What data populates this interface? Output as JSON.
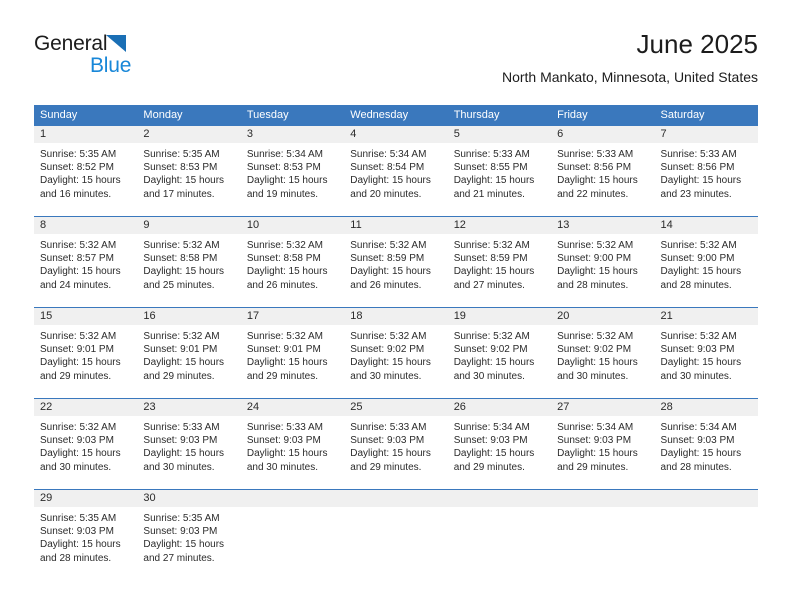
{
  "logo": {
    "word1": "General",
    "word2": "Blue",
    "triangle_color": "#1a6fb5",
    "word2_color": "#1887d8"
  },
  "header": {
    "title": "June 2025",
    "location": "North Mankato, Minnesota, United States"
  },
  "theme": {
    "header_blue": "#3a78bd",
    "day_band_gray": "#f0f0f0",
    "text": "#2b2b2b"
  },
  "weekday_headers": [
    "Sunday",
    "Monday",
    "Tuesday",
    "Wednesday",
    "Thursday",
    "Friday",
    "Saturday"
  ],
  "labels": {
    "sunrise_prefix": "Sunrise:",
    "sunset_prefix": "Sunset:",
    "daylight_prefix": "Daylight:"
  },
  "weeks": [
    [
      {
        "day": "1",
        "sunrise": "Sunrise: 5:35 AM",
        "sunset": "Sunset: 8:52 PM",
        "daylight1": "Daylight: 15 hours",
        "daylight2": "and 16 minutes."
      },
      {
        "day": "2",
        "sunrise": "Sunrise: 5:35 AM",
        "sunset": "Sunset: 8:53 PM",
        "daylight1": "Daylight: 15 hours",
        "daylight2": "and 17 minutes."
      },
      {
        "day": "3",
        "sunrise": "Sunrise: 5:34 AM",
        "sunset": "Sunset: 8:53 PM",
        "daylight1": "Daylight: 15 hours",
        "daylight2": "and 19 minutes."
      },
      {
        "day": "4",
        "sunrise": "Sunrise: 5:34 AM",
        "sunset": "Sunset: 8:54 PM",
        "daylight1": "Daylight: 15 hours",
        "daylight2": "and 20 minutes."
      },
      {
        "day": "5",
        "sunrise": "Sunrise: 5:33 AM",
        "sunset": "Sunset: 8:55 PM",
        "daylight1": "Daylight: 15 hours",
        "daylight2": "and 21 minutes."
      },
      {
        "day": "6",
        "sunrise": "Sunrise: 5:33 AM",
        "sunset": "Sunset: 8:56 PM",
        "daylight1": "Daylight: 15 hours",
        "daylight2": "and 22 minutes."
      },
      {
        "day": "7",
        "sunrise": "Sunrise: 5:33 AM",
        "sunset": "Sunset: 8:56 PM",
        "daylight1": "Daylight: 15 hours",
        "daylight2": "and 23 minutes."
      }
    ],
    [
      {
        "day": "8",
        "sunrise": "Sunrise: 5:32 AM",
        "sunset": "Sunset: 8:57 PM",
        "daylight1": "Daylight: 15 hours",
        "daylight2": "and 24 minutes."
      },
      {
        "day": "9",
        "sunrise": "Sunrise: 5:32 AM",
        "sunset": "Sunset: 8:58 PM",
        "daylight1": "Daylight: 15 hours",
        "daylight2": "and 25 minutes."
      },
      {
        "day": "10",
        "sunrise": "Sunrise: 5:32 AM",
        "sunset": "Sunset: 8:58 PM",
        "daylight1": "Daylight: 15 hours",
        "daylight2": "and 26 minutes."
      },
      {
        "day": "11",
        "sunrise": "Sunrise: 5:32 AM",
        "sunset": "Sunset: 8:59 PM",
        "daylight1": "Daylight: 15 hours",
        "daylight2": "and 26 minutes."
      },
      {
        "day": "12",
        "sunrise": "Sunrise: 5:32 AM",
        "sunset": "Sunset: 8:59 PM",
        "daylight1": "Daylight: 15 hours",
        "daylight2": "and 27 minutes."
      },
      {
        "day": "13",
        "sunrise": "Sunrise: 5:32 AM",
        "sunset": "Sunset: 9:00 PM",
        "daylight1": "Daylight: 15 hours",
        "daylight2": "and 28 minutes."
      },
      {
        "day": "14",
        "sunrise": "Sunrise: 5:32 AM",
        "sunset": "Sunset: 9:00 PM",
        "daylight1": "Daylight: 15 hours",
        "daylight2": "and 28 minutes."
      }
    ],
    [
      {
        "day": "15",
        "sunrise": "Sunrise: 5:32 AM",
        "sunset": "Sunset: 9:01 PM",
        "daylight1": "Daylight: 15 hours",
        "daylight2": "and 29 minutes."
      },
      {
        "day": "16",
        "sunrise": "Sunrise: 5:32 AM",
        "sunset": "Sunset: 9:01 PM",
        "daylight1": "Daylight: 15 hours",
        "daylight2": "and 29 minutes."
      },
      {
        "day": "17",
        "sunrise": "Sunrise: 5:32 AM",
        "sunset": "Sunset: 9:01 PM",
        "daylight1": "Daylight: 15 hours",
        "daylight2": "and 29 minutes."
      },
      {
        "day": "18",
        "sunrise": "Sunrise: 5:32 AM",
        "sunset": "Sunset: 9:02 PM",
        "daylight1": "Daylight: 15 hours",
        "daylight2": "and 30 minutes."
      },
      {
        "day": "19",
        "sunrise": "Sunrise: 5:32 AM",
        "sunset": "Sunset: 9:02 PM",
        "daylight1": "Daylight: 15 hours",
        "daylight2": "and 30 minutes."
      },
      {
        "day": "20",
        "sunrise": "Sunrise: 5:32 AM",
        "sunset": "Sunset: 9:02 PM",
        "daylight1": "Daylight: 15 hours",
        "daylight2": "and 30 minutes."
      },
      {
        "day": "21",
        "sunrise": "Sunrise: 5:32 AM",
        "sunset": "Sunset: 9:03 PM",
        "daylight1": "Daylight: 15 hours",
        "daylight2": "and 30 minutes."
      }
    ],
    [
      {
        "day": "22",
        "sunrise": "Sunrise: 5:32 AM",
        "sunset": "Sunset: 9:03 PM",
        "daylight1": "Daylight: 15 hours",
        "daylight2": "and 30 minutes."
      },
      {
        "day": "23",
        "sunrise": "Sunrise: 5:33 AM",
        "sunset": "Sunset: 9:03 PM",
        "daylight1": "Daylight: 15 hours",
        "daylight2": "and 30 minutes."
      },
      {
        "day": "24",
        "sunrise": "Sunrise: 5:33 AM",
        "sunset": "Sunset: 9:03 PM",
        "daylight1": "Daylight: 15 hours",
        "daylight2": "and 30 minutes."
      },
      {
        "day": "25",
        "sunrise": "Sunrise: 5:33 AM",
        "sunset": "Sunset: 9:03 PM",
        "daylight1": "Daylight: 15 hours",
        "daylight2": "and 29 minutes."
      },
      {
        "day": "26",
        "sunrise": "Sunrise: 5:34 AM",
        "sunset": "Sunset: 9:03 PM",
        "daylight1": "Daylight: 15 hours",
        "daylight2": "and 29 minutes."
      },
      {
        "day": "27",
        "sunrise": "Sunrise: 5:34 AM",
        "sunset": "Sunset: 9:03 PM",
        "daylight1": "Daylight: 15 hours",
        "daylight2": "and 29 minutes."
      },
      {
        "day": "28",
        "sunrise": "Sunrise: 5:34 AM",
        "sunset": "Sunset: 9:03 PM",
        "daylight1": "Daylight: 15 hours",
        "daylight2": "and 28 minutes."
      }
    ],
    [
      {
        "day": "29",
        "sunrise": "Sunrise: 5:35 AM",
        "sunset": "Sunset: 9:03 PM",
        "daylight1": "Daylight: 15 hours",
        "daylight2": "and 28 minutes."
      },
      {
        "day": "30",
        "sunrise": "Sunrise: 5:35 AM",
        "sunset": "Sunset: 9:03 PM",
        "daylight1": "Daylight: 15 hours",
        "daylight2": "and 27 minutes."
      },
      {
        "day": "",
        "sunrise": "",
        "sunset": "",
        "daylight1": "",
        "daylight2": ""
      },
      {
        "day": "",
        "sunrise": "",
        "sunset": "",
        "daylight1": "",
        "daylight2": ""
      },
      {
        "day": "",
        "sunrise": "",
        "sunset": "",
        "daylight1": "",
        "daylight2": ""
      },
      {
        "day": "",
        "sunrise": "",
        "sunset": "",
        "daylight1": "",
        "daylight2": ""
      },
      {
        "day": "",
        "sunrise": "",
        "sunset": "",
        "daylight1": "",
        "daylight2": ""
      }
    ]
  ]
}
